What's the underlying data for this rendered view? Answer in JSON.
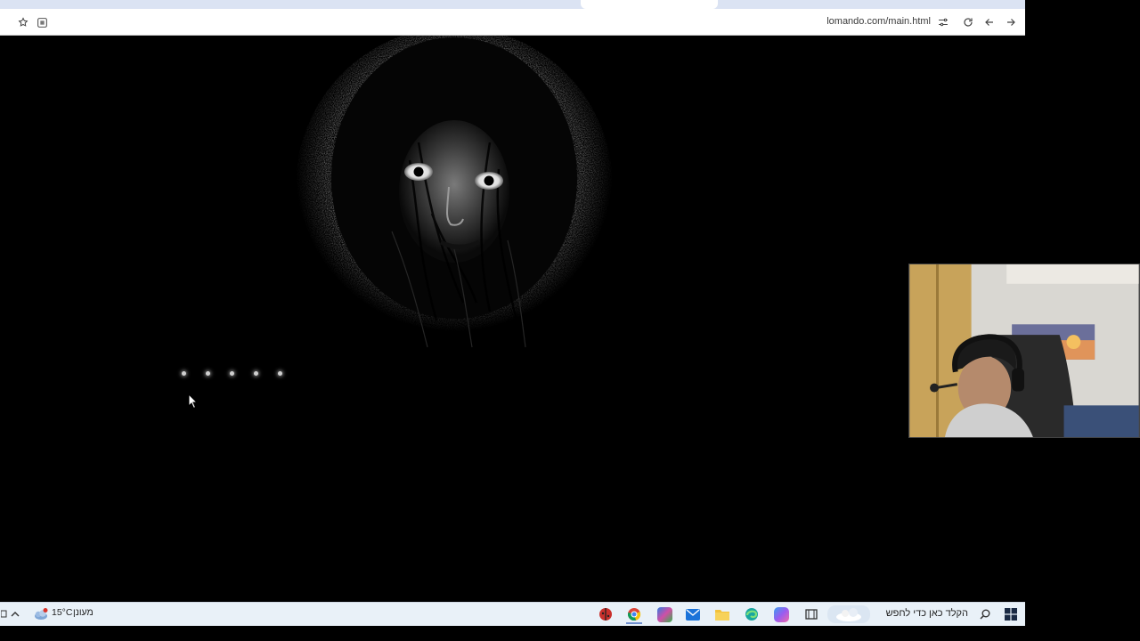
{
  "browser": {
    "url": "lomando.com/main.html",
    "icons": [
      "star-icon",
      "extension-icon",
      "site-settings-icon",
      "reload-icon",
      "back-arrow-icon",
      "forward-arrow-icon"
    ]
  },
  "game": {
    "loading_dots": 5,
    "scene": "dark figure peering from a hooded veil"
  },
  "taskbar": {
    "weather_temp": "15°C",
    "weather_condition": "מעונן",
    "weather_badge": "!",
    "search_placeholder": "הקלד כאן כדי לחפש",
    "apps": [
      "ladybug-app-icon",
      "chrome-icon",
      "m365-icon",
      "mail-icon",
      "file-explorer-icon",
      "edge-icon",
      "copilot-icon",
      "task-view-icon"
    ]
  },
  "colors": {
    "taskbar_bg": "#e9f1f8",
    "toolbar_bg": "#ffffff",
    "viewport_bg": "#000000"
  }
}
